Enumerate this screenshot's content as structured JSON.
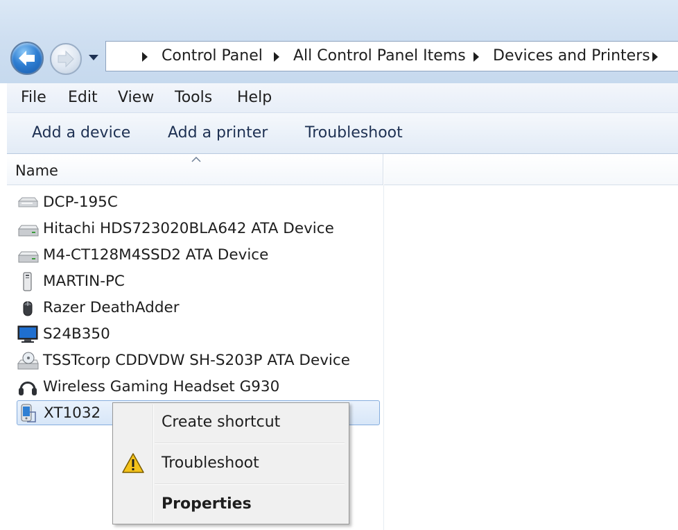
{
  "address": {
    "crumbs": [
      "Control Panel",
      "All Control Panel Items",
      "Devices and Printers"
    ]
  },
  "menu": [
    "File",
    "Edit",
    "View",
    "Tools",
    "Help"
  ],
  "commands": [
    "Add a device",
    "Add a printer",
    "Troubleshoot"
  ],
  "list": {
    "column_header": "Name",
    "items": [
      {
        "label": "DCP-195C",
        "icon": "printer-icon"
      },
      {
        "label": "Hitachi HDS723020BLA642 ATA Device",
        "icon": "hard-drive-icon"
      },
      {
        "label": "M4-CT128M4SSD2 ATA Device",
        "icon": "hard-drive-icon"
      },
      {
        "label": "MARTIN-PC",
        "icon": "computer-tower-icon"
      },
      {
        "label": "Razer DeathAdder",
        "icon": "mouse-icon"
      },
      {
        "label": "S24B350",
        "icon": "monitor-icon"
      },
      {
        "label": "TSSTcorp CDDVDW SH-S203P ATA Device",
        "icon": "optical-drive-icon"
      },
      {
        "label": "Wireless Gaming Headset G930",
        "icon": "headset-icon"
      },
      {
        "label": "XT1032",
        "icon": "phone-icon",
        "selected": true
      }
    ]
  },
  "context_menu": {
    "items": [
      {
        "label": "Create shortcut",
        "icon": null
      },
      {
        "label": "Troubleshoot",
        "icon": "warning-icon"
      },
      {
        "label": "Properties",
        "icon": null,
        "bold": true
      }
    ]
  },
  "colors": {
    "selection_border": "#84acdd",
    "nav_back": "#2f7fd3",
    "warning": "#f4c21a"
  }
}
